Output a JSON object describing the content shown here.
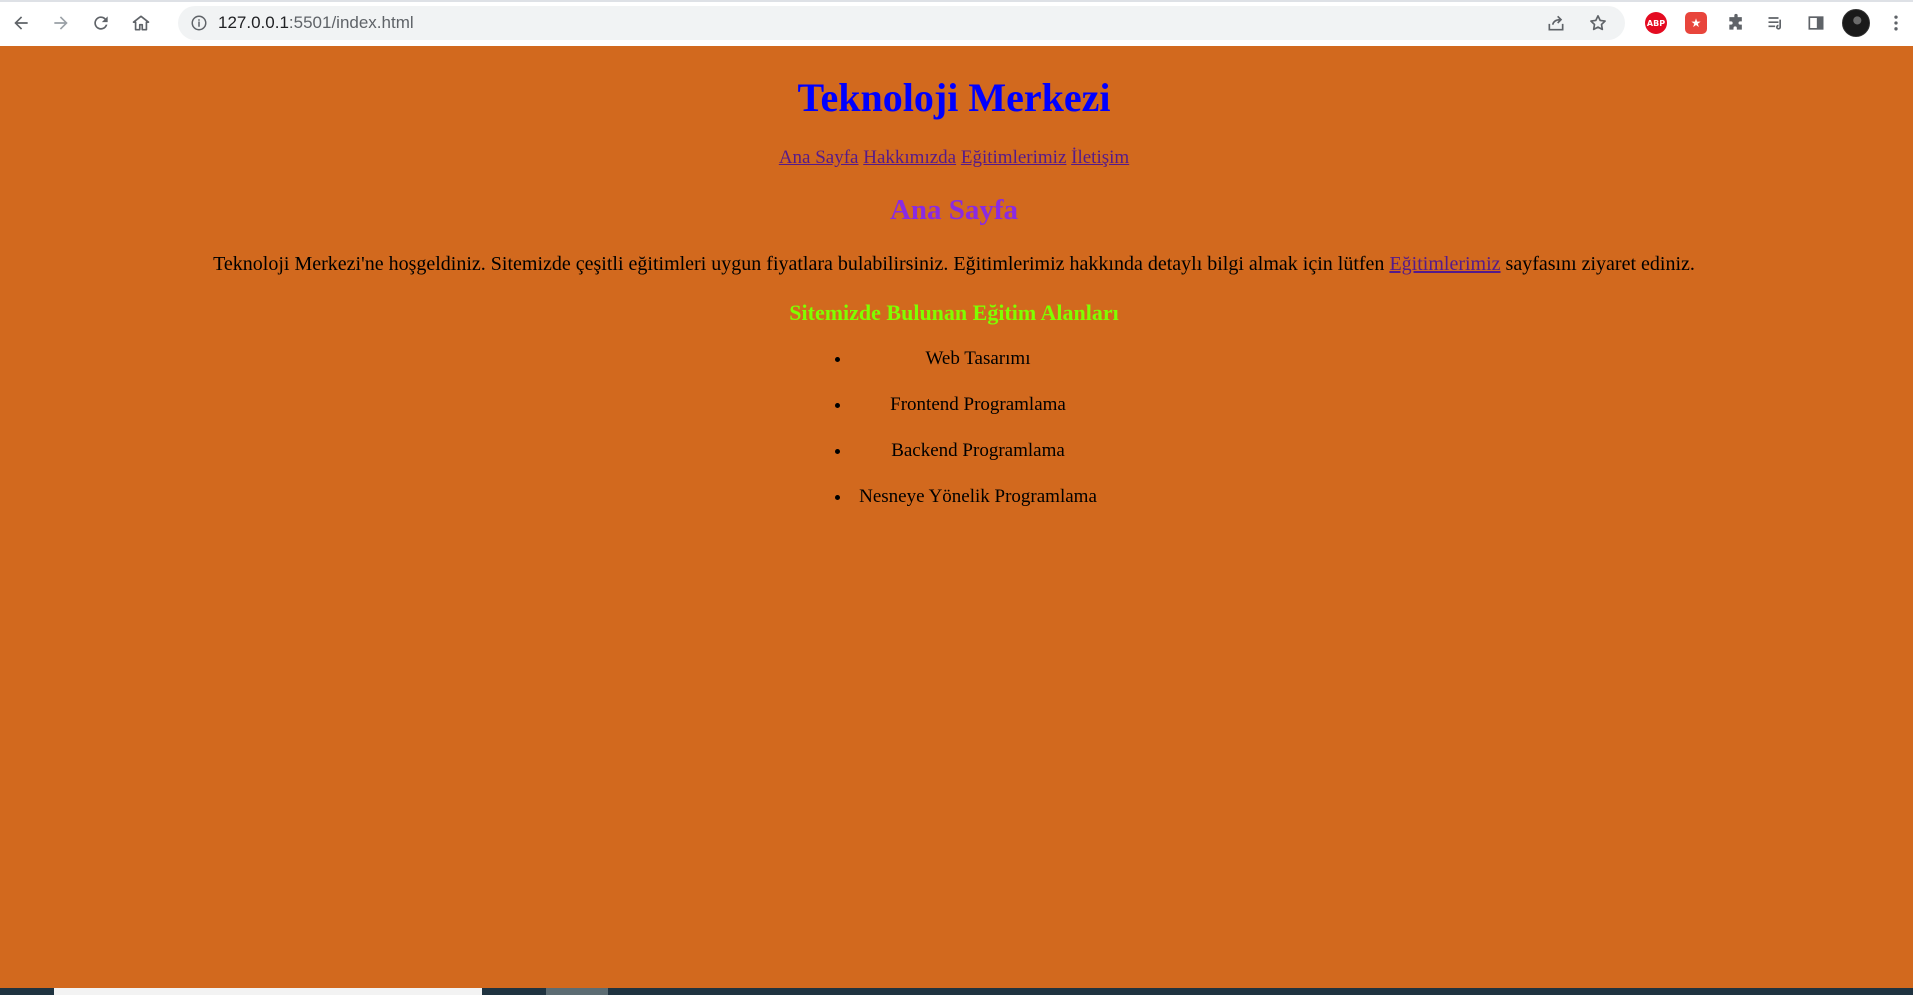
{
  "browser": {
    "url_host": "127.0.0.1",
    "url_path": ":5501/index.html",
    "back_icon": "arrow-left-icon",
    "forward_icon": "arrow-right-icon",
    "reload_icon": "reload-icon",
    "home_icon": "home-icon",
    "abp_label": "ABP"
  },
  "page": {
    "site_title": "Teknoloji Merkezi",
    "nav": [
      "Ana Sayfa",
      "Hakkımızda",
      "Eğitimlerimiz",
      "İletişim"
    ],
    "section_title": "Ana Sayfa",
    "intro_before": "Teknoloji Merkezi'ne hoşgeldiniz. Sitemizde çeşitli eğitimleri uygun fiyatlara bulabilirsiniz. Eğitimlerimiz hakkında detaylı bilgi almak için lütfen ",
    "intro_link": "Eğitimlerimiz",
    "intro_after": " sayfasını ziyaret ediniz.",
    "areas_title": "Sitemizde Bulunan Eğitim Alanları",
    "areas": [
      "Web Tasarımı",
      "Frontend Programlama",
      "Backend Programlama",
      "Nesneye Yönelik Programlama"
    ]
  },
  "colors": {
    "background": "#d2691e",
    "title": "#0000ff",
    "section_title": "#8a2be2",
    "areas_title": "#7fff00",
    "link": "#551a8b"
  }
}
